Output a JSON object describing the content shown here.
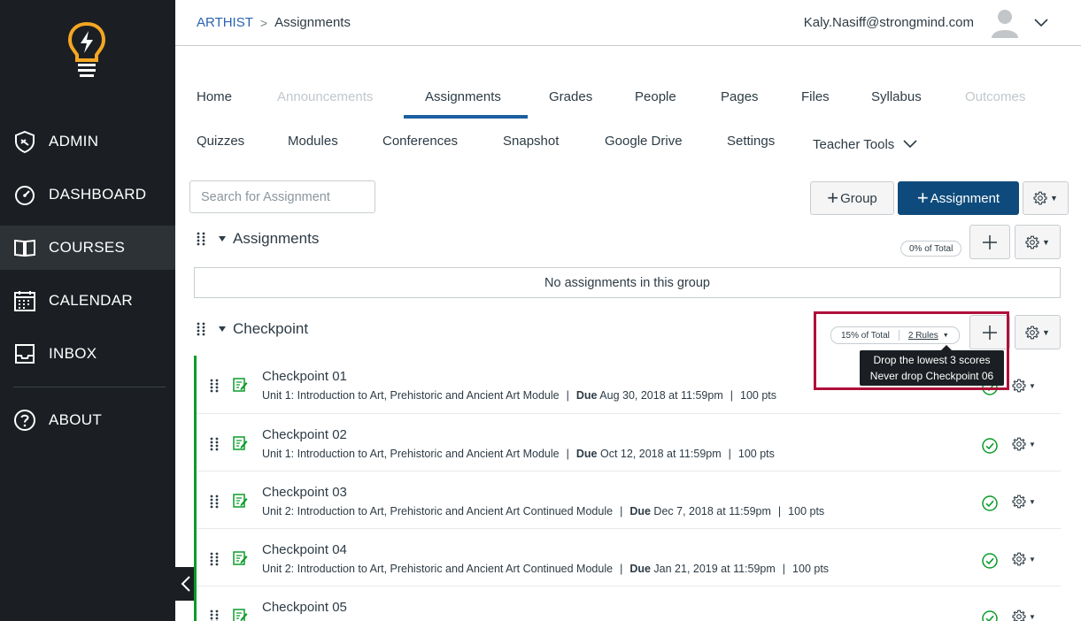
{
  "sidebar": {
    "items": [
      {
        "label": "ADMIN",
        "icon": "shield-icon"
      },
      {
        "label": "DASHBOARD",
        "icon": "speedometer-icon"
      },
      {
        "label": "COURSES",
        "icon": "book-icon"
      },
      {
        "label": "CALENDAR",
        "icon": "calendar-icon"
      },
      {
        "label": "INBOX",
        "icon": "inbox-icon"
      },
      {
        "label": "ABOUT",
        "icon": "help-icon"
      }
    ],
    "active": "COURSES"
  },
  "header": {
    "breadcrumb_course": "ARTHIST",
    "breadcrumb_separator": ">",
    "breadcrumb_page": "Assignments",
    "user_email": "Kaly.Nasiff@strongmind.com"
  },
  "tabs": {
    "row1": [
      "Home",
      "Announcements",
      "Assignments",
      "Grades",
      "People",
      "Pages",
      "Files",
      "Syllabus",
      "Outcomes"
    ],
    "row2": [
      "Quizzes",
      "Modules",
      "Conferences",
      "Snapshot",
      "Google Drive",
      "Settings",
      "Teacher Tools"
    ],
    "active": "Assignments",
    "disabled": [
      "Announcements",
      "Outcomes"
    ]
  },
  "toolbar": {
    "search_placeholder": "Search for Assignment",
    "group_button": "Group",
    "assignment_button": "Assignment"
  },
  "groups": [
    {
      "title": "Assignments",
      "weight": "0% of Total",
      "empty_text": "No assignments in this group"
    },
    {
      "title": "Checkpoint",
      "weight": "15% of Total",
      "rules": "2 Rules",
      "tooltip": [
        "Drop the lowest 3 scores",
        "Never drop Checkpoint 06"
      ]
    }
  ],
  "assignments": [
    {
      "title": "Checkpoint 01",
      "module": "Unit 1: Introduction to Art, Prehistoric and Ancient Art Module",
      "due_label": "Due",
      "due": "Aug 30, 2018 at 11:59pm",
      "points": "100 pts"
    },
    {
      "title": "Checkpoint 02",
      "module": "Unit 1: Introduction to Art, Prehistoric and Ancient Art Module",
      "due_label": "Due",
      "due": "Oct 12, 2018 at 11:59pm",
      "points": "100 pts"
    },
    {
      "title": "Checkpoint 03",
      "module": "Unit 2: Introduction to Art, Prehistoric and Ancient Art Continued Module",
      "due_label": "Due",
      "due": "Dec 7, 2018 at 11:59pm",
      "points": "100 pts"
    },
    {
      "title": "Checkpoint 04",
      "module": "Unit 2: Introduction to Art, Prehistoric and Ancient Art Continued Module",
      "due_label": "Due",
      "due": "Jan 21, 2019 at 11:59pm",
      "points": "100 pts"
    },
    {
      "title": "Checkpoint 05",
      "module": "",
      "due_label": "",
      "due": "",
      "points": ""
    }
  ],
  "colors": {
    "sidebar_bg": "#1b1f23",
    "link": "#2b63b0",
    "primary_button": "#0e4b7c",
    "published_green": "#0b9c2a",
    "highlight_red": "#b0103b",
    "logo_orange": "#f5a623"
  }
}
